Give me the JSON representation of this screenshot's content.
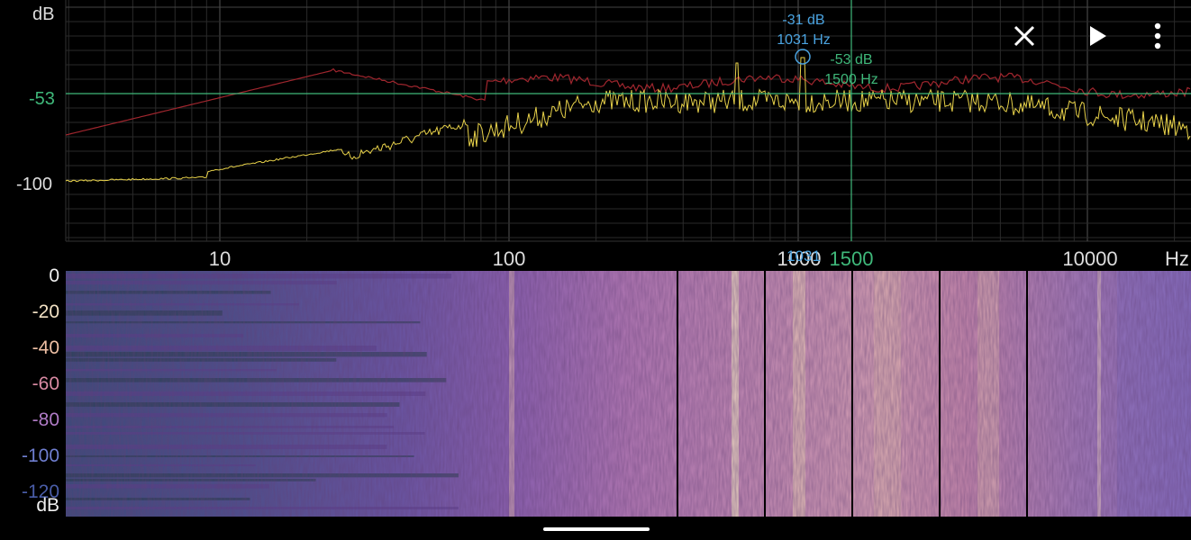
{
  "spectrum": {
    "db_unit": "dB",
    "hz_unit": "Hz",
    "db_ticks": [
      "-100"
    ],
    "freq_ticks": [
      "10",
      "100",
      "1000",
      "10000"
    ],
    "peak": {
      "db_text": "-31 dB",
      "hz_text": "1031 Hz",
      "axis_marker": "1031"
    },
    "cursor": {
      "db_text": "-53 dB",
      "hz_text": "1500 Hz",
      "axis_marker": "1500",
      "left_axis_value": "-53"
    }
  },
  "spectrogram": {
    "level_ticks": [
      "0",
      "-20",
      "-40",
      "-60",
      "-80",
      "-100",
      "-120"
    ],
    "db_unit": "dB"
  },
  "toolbar": {
    "close_icon": "close-icon",
    "play_icon": "play-icon",
    "more_icon": "more-vert-icon"
  },
  "colors": {
    "background": "#000000",
    "grid": "#3a3a3a",
    "peak_hold_line": "#a0262e",
    "spectrum_line": "#e8d24a",
    "peak_marker": "#4aa3e0",
    "cursor": "#3fb87a"
  }
}
